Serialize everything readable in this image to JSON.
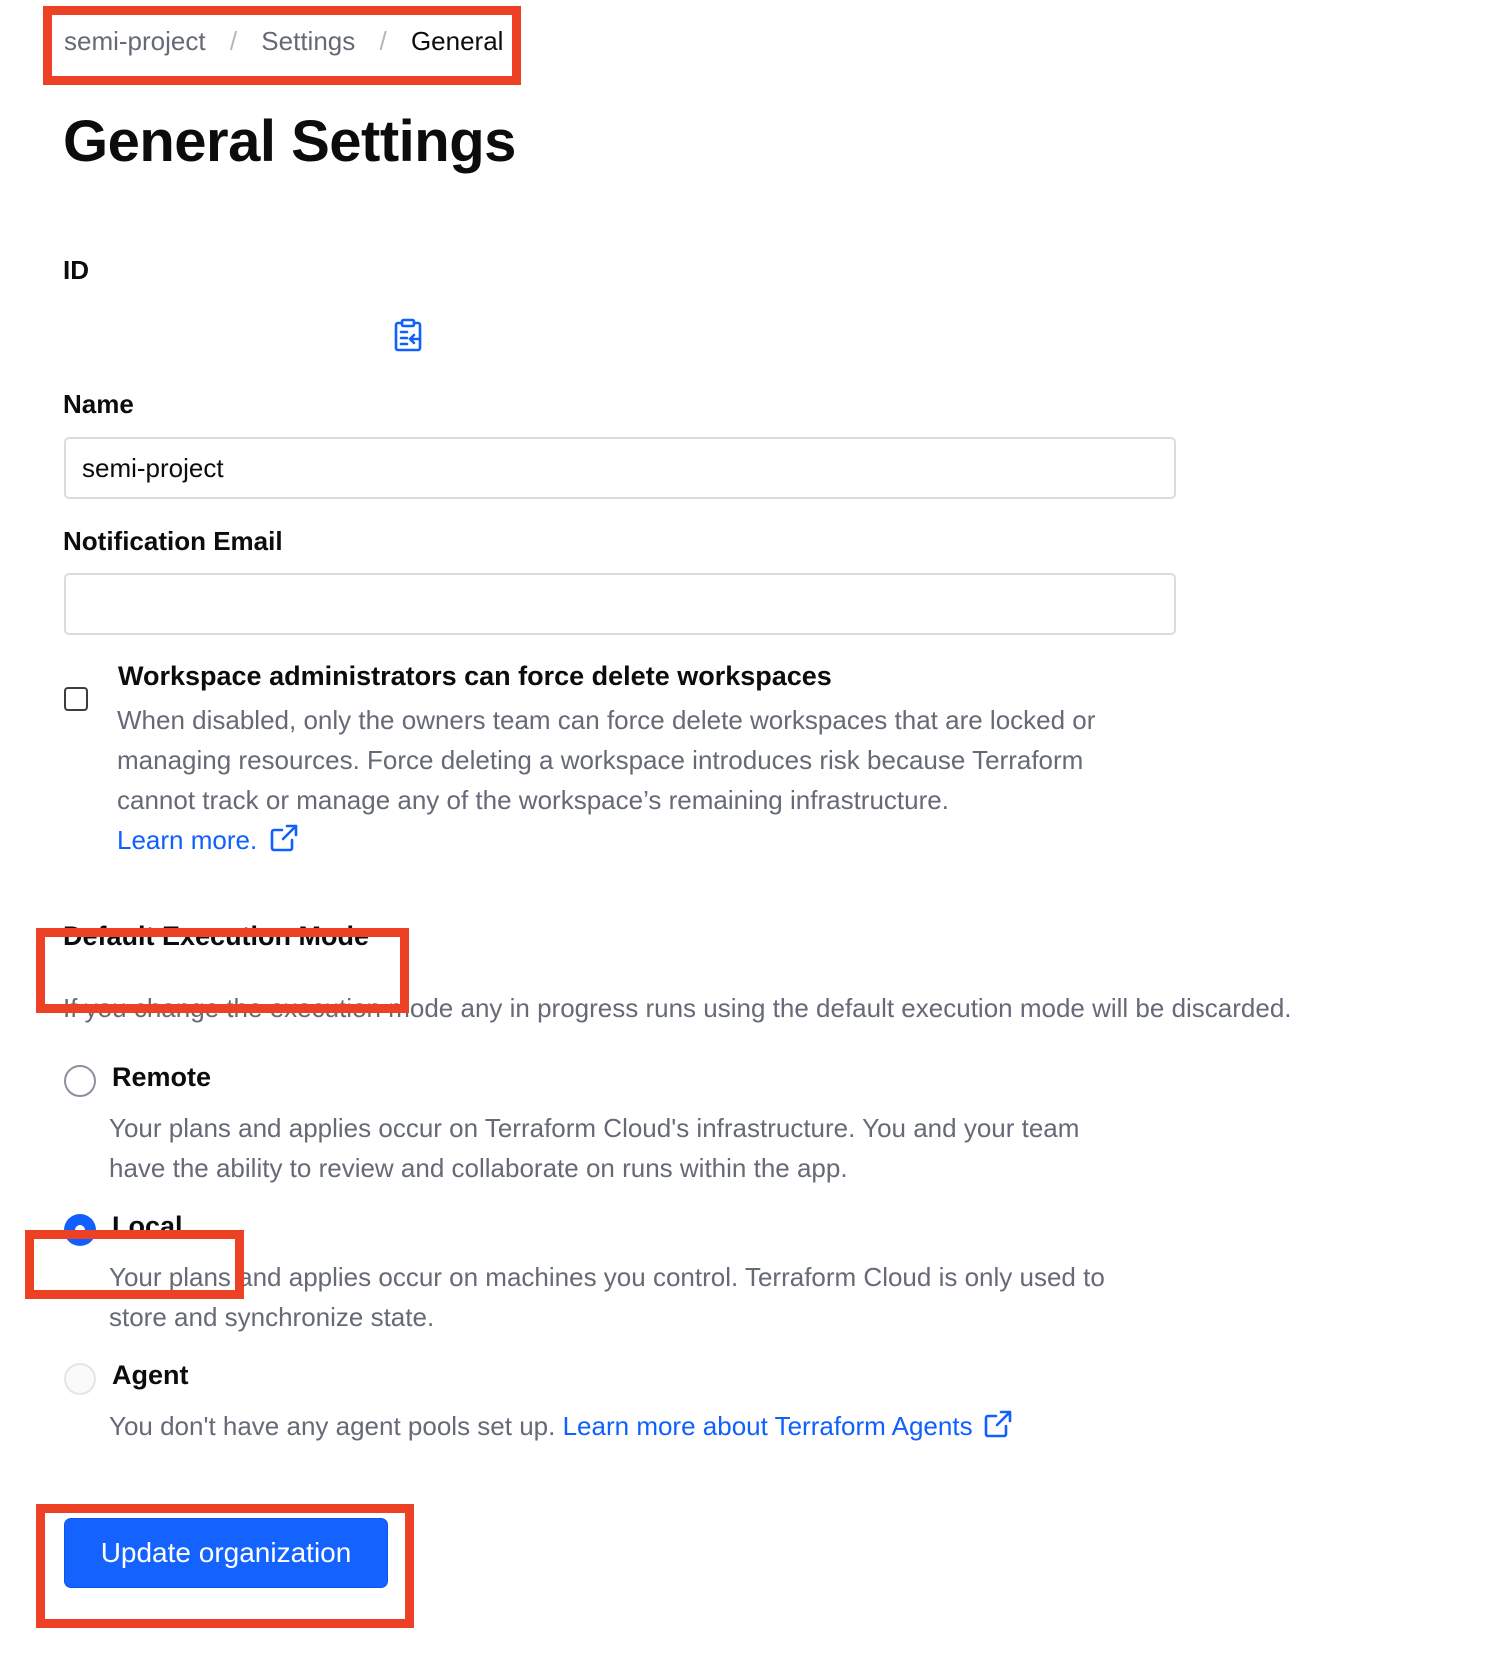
{
  "breadcrumb": {
    "items": [
      "semi-project",
      "Settings",
      "General"
    ],
    "separator": "/"
  },
  "page_title": "General Settings",
  "id_section": {
    "label": "ID",
    "copy_icon": "clipboard-copy-icon"
  },
  "name_field": {
    "label": "Name",
    "value": "semi-project"
  },
  "email_field": {
    "label": "Notification Email",
    "value": ""
  },
  "force_delete": {
    "checked": false,
    "label": "Workspace administrators can force delete workspaces",
    "desc_line1": "When disabled, only the owners team can force delete workspaces that are locked or",
    "desc_line2": "managing resources. Force deleting a workspace introduces risk because Terraform",
    "desc_line3": "cannot track or manage any of the workspace’s remaining infrastructure.",
    "link_text": "Learn more.",
    "link_icon": "external-link-icon"
  },
  "execution_mode": {
    "label": "Default Execution Mode",
    "description": "If you change the execution mode any in progress runs using the default execution mode will be discarded.",
    "selected": "Local",
    "options": [
      {
        "label": "Remote",
        "desc_line1": "Your plans and applies occur on Terraform Cloud's infrastructure. You and your team",
        "desc_line2": "have the ability to review and collaborate on runs within the app."
      },
      {
        "label": "Local",
        "desc_line1": "Your plans and applies occur on machines you control. Terraform Cloud is only used to",
        "desc_line2": "store and synchronize state."
      },
      {
        "label": "Agent",
        "disabled": true,
        "desc_text": "You don't have any agent pools set up.",
        "link_text": "Learn more about Terraform Agents"
      }
    ]
  },
  "submit_button": "Update organization",
  "colors": {
    "accent": "#1060ff",
    "highlight_box": "#ec4125",
    "muted_text": "#656a76"
  }
}
